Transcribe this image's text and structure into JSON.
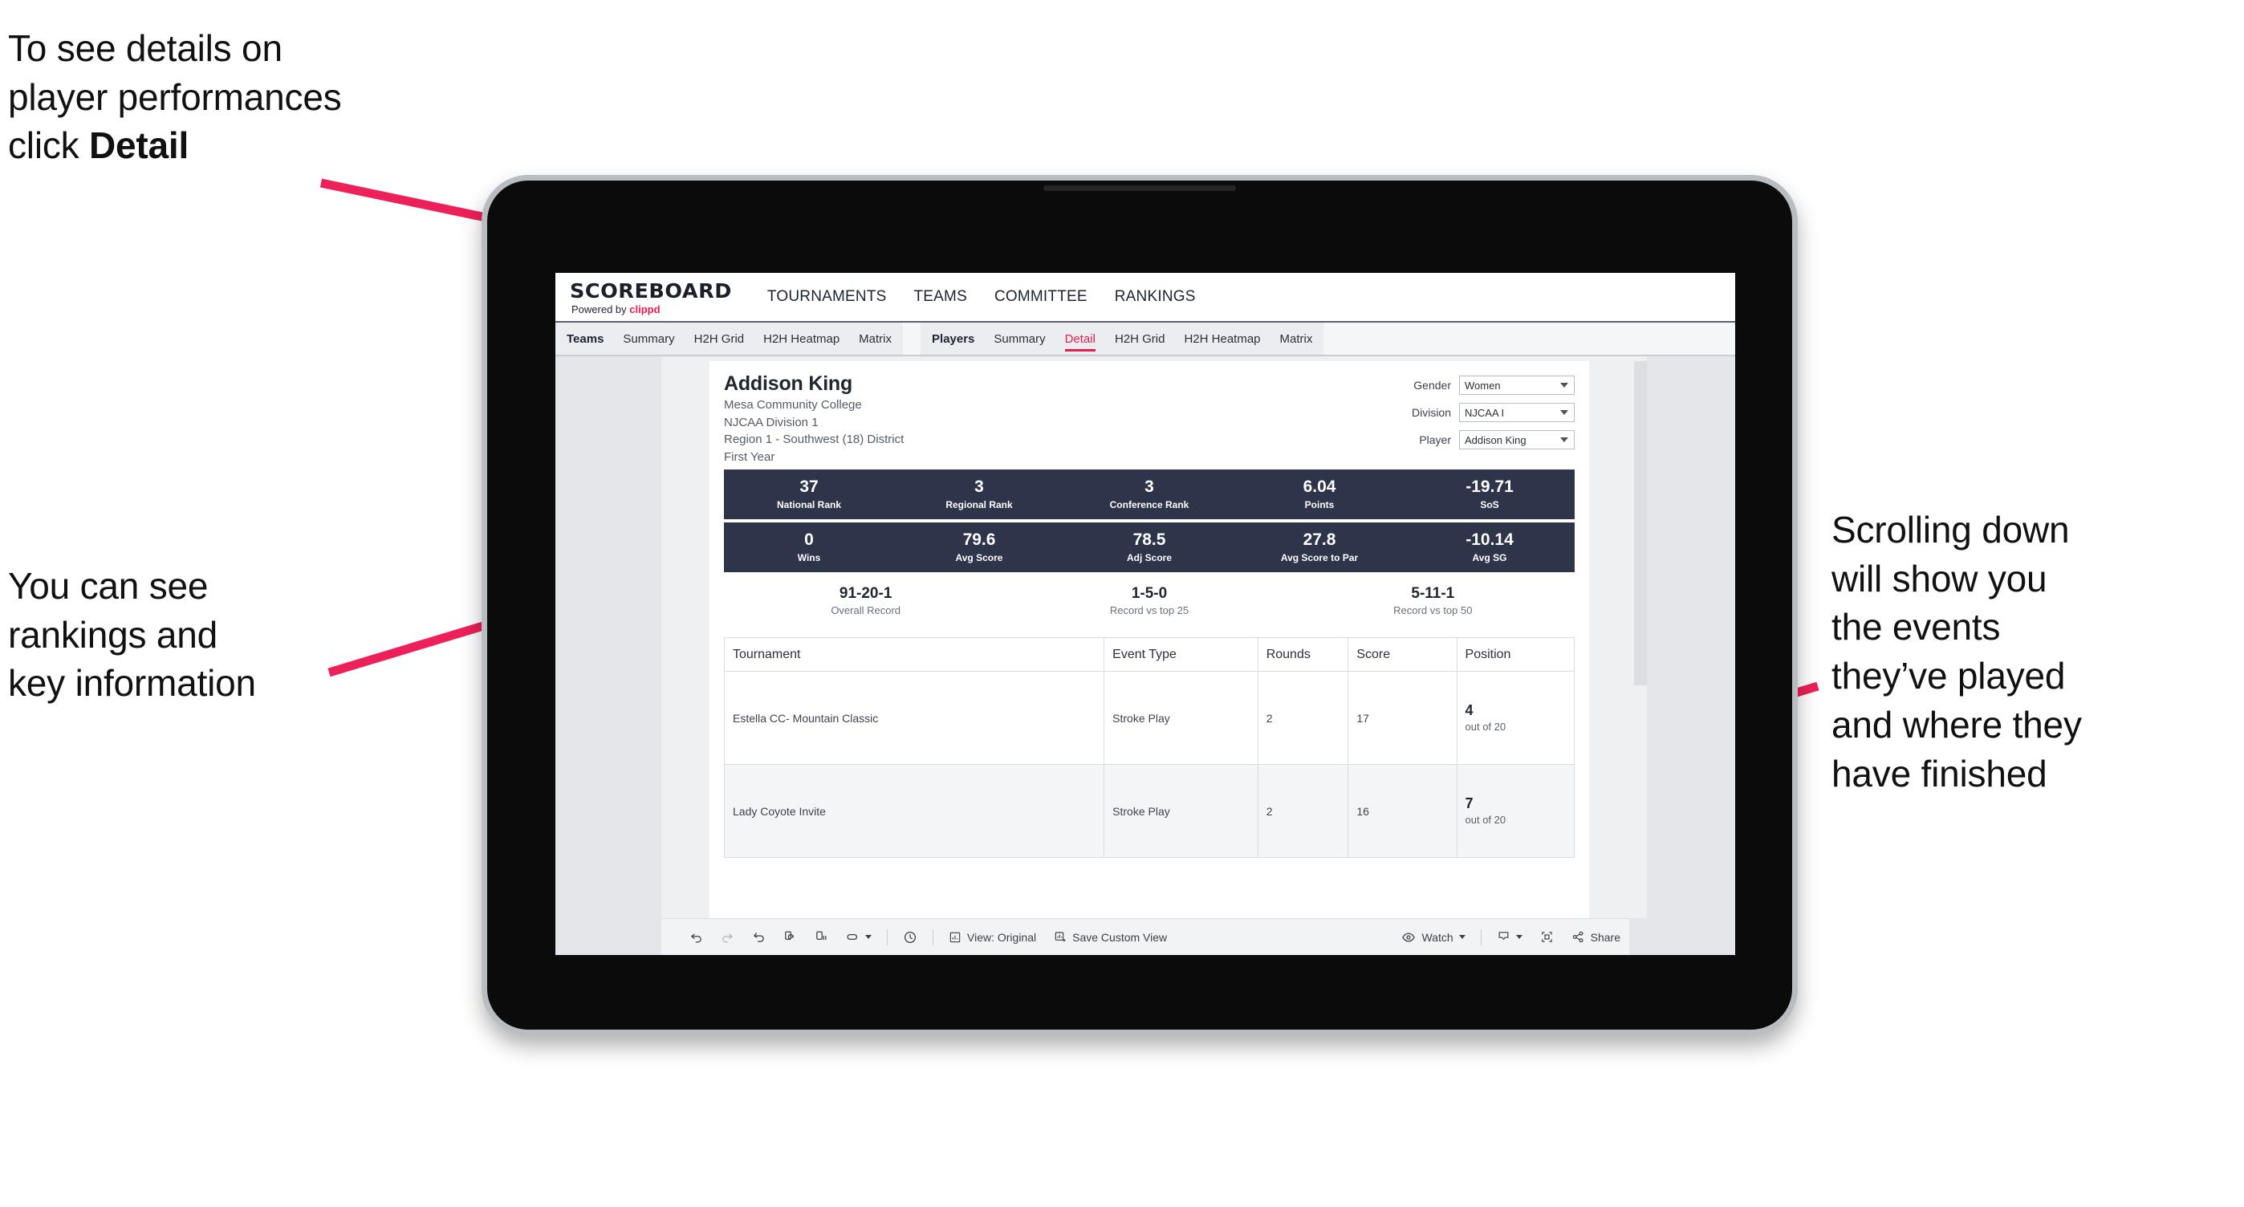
{
  "annotations": {
    "top_left": "To see details on\nplayer performances\nclick ",
    "top_left_bold": "Detail",
    "mid_left": "You can see\nrankings and\nkey information",
    "right": "Scrolling down\nwill show you\nthe events\nthey’ve played\nand where they\nhave finished",
    "arrow_color": "#ed2059"
  },
  "app": {
    "brand": {
      "word": "SCOREBOARD",
      "powered_prefix": "Powered by ",
      "powered_name": "clippd"
    },
    "topnav": [
      "TOURNAMENTS",
      "TEAMS",
      "COMMITTEE",
      "RANKINGS"
    ],
    "tabs": {
      "teams_group": {
        "lead": "Teams",
        "items": [
          "Summary",
          "H2H Grid",
          "H2H Heatmap",
          "Matrix"
        ]
      },
      "players_group": {
        "lead": "Players",
        "items": [
          "Summary",
          "Detail",
          "H2H Grid",
          "H2H Heatmap",
          "Matrix"
        ],
        "active": "Detail"
      }
    },
    "accent": "#ec1c4b",
    "stat_bar_color": "#2e3449"
  },
  "player": {
    "name": "Addison King",
    "school": "Mesa Community College",
    "division": "NJCAA Division 1",
    "region": "Region 1 - Southwest (18) District",
    "year": "First Year"
  },
  "filters": [
    {
      "label": "Gender",
      "value": "Women"
    },
    {
      "label": "Division",
      "value": "NJCAA I"
    },
    {
      "label": "Player",
      "value": "Addison King"
    }
  ],
  "stats_row_1": [
    {
      "value": "37",
      "label": "National Rank"
    },
    {
      "value": "3",
      "label": "Regional Rank"
    },
    {
      "value": "3",
      "label": "Conference Rank"
    },
    {
      "value": "6.04",
      "label": "Points"
    },
    {
      "value": "-19.71",
      "label": "SoS"
    }
  ],
  "stats_row_2": [
    {
      "value": "0",
      "label": "Wins"
    },
    {
      "value": "79.6",
      "label": "Avg Score"
    },
    {
      "value": "78.5",
      "label": "Adj Score"
    },
    {
      "value": "27.8",
      "label": "Avg Score to Par"
    },
    {
      "value": "-10.14",
      "label": "Avg SG"
    }
  ],
  "records": [
    {
      "value": "91-20-1",
      "label": "Overall Record"
    },
    {
      "value": "1-5-0",
      "label": "Record vs top 25"
    },
    {
      "value": "5-11-1",
      "label": "Record vs top 50"
    }
  ],
  "events_table": {
    "headers": [
      "Tournament",
      "Event Type",
      "Rounds",
      "Score",
      "Position"
    ],
    "rows": [
      {
        "tournament": "Estella CC- Mountain Classic",
        "event_type": "Stroke Play",
        "rounds": "2",
        "score": "17",
        "position": "4",
        "position_of": "out of 20"
      },
      {
        "tournament": "Lady Coyote Invite",
        "event_type": "Stroke Play",
        "rounds": "2",
        "score": "16",
        "position": "7",
        "position_of": "out of 20"
      }
    ]
  },
  "toolbar": {
    "undo": "undo-icon",
    "redo": "redo-icon",
    "revert": "revert-icon",
    "refresh": "refresh-data-icon",
    "pause": "pause-auto-update-icon",
    "alerts": "alerts-icon",
    "clock": "clock-icon",
    "view_label": "View: Original",
    "save_label": "Save Custom View",
    "watch_label": "Watch",
    "download": "download-icon",
    "fullscreen": "fullscreen-icon",
    "share_label": "Share"
  }
}
